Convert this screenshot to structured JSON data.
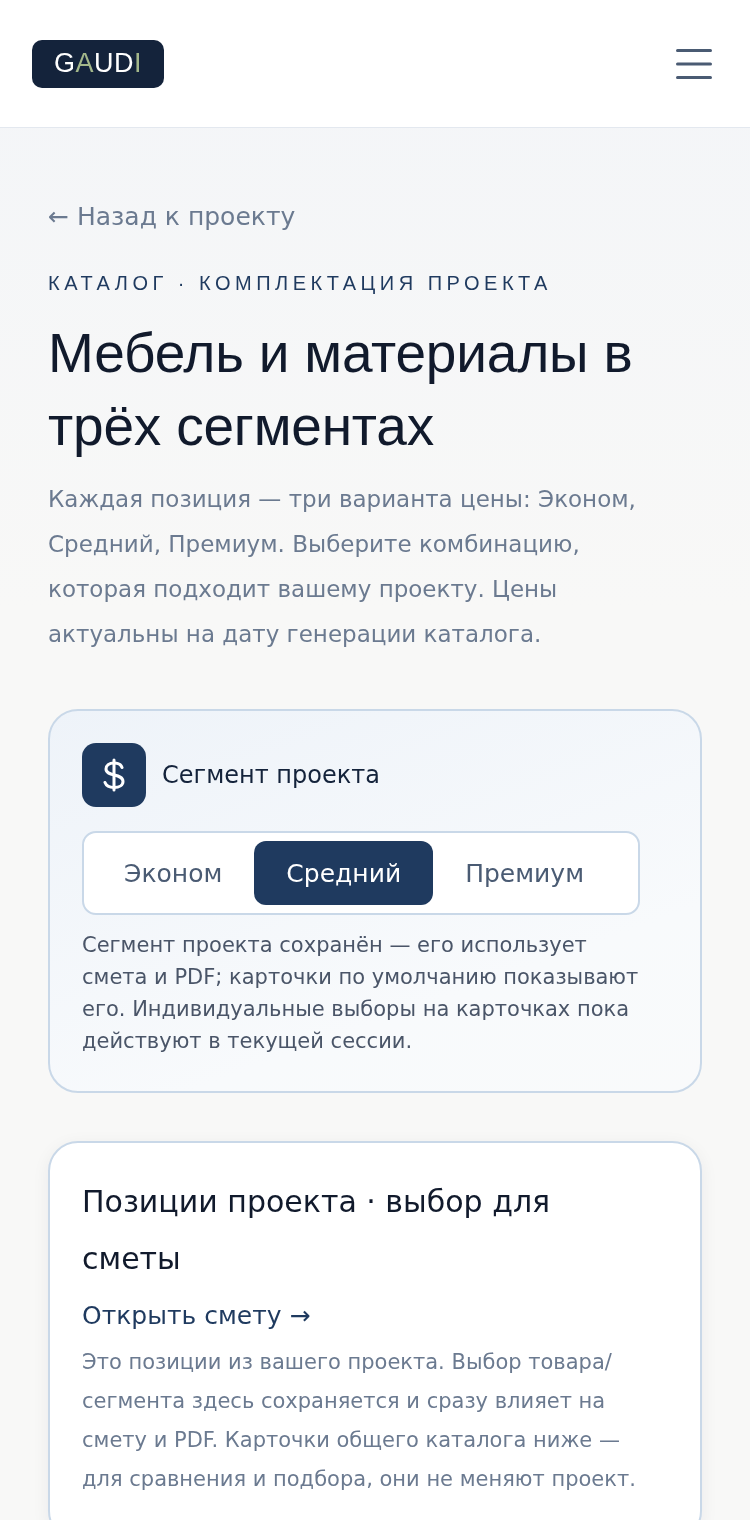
{
  "header": {
    "logo": [
      {
        "text": "G",
        "accent": false
      },
      {
        "text": "A",
        "accent": true
      },
      {
        "text": "UD",
        "accent": false
      },
      {
        "text": "I",
        "accent": true
      }
    ]
  },
  "back_link": "← Назад к проекту",
  "eyebrow": "КАТАЛОГ · КОМПЛЕКТАЦИЯ ПРОЕКТА",
  "title": "Мебель и материалы в трёх сегментах",
  "intro": "Каждая позиция — три варианта цены: Эконом, Средний, Премиум. Выберите комбинацию, которая подходит вашему проекту. Цены актуальны на дату генерации каталога.",
  "segment_card": {
    "title": "Сегмент проекта",
    "options": [
      {
        "label": "Эконом",
        "selected": false
      },
      {
        "label": "Средний",
        "selected": true
      },
      {
        "label": "Премиум",
        "selected": false
      }
    ],
    "note": "Сегмент проекта сохранён — его использует смета и PDF; карточки по умолчанию показывают его. Индивидуальные выборы на карточках пока действуют в текущей сессии."
  },
  "positions_card": {
    "title": "Позиции проекта · выбор для сметы",
    "link": "Открыть смету →",
    "description": "Это позиции из вашего проекта. Выбор товара/ сегмента здесь сохраняется и сразу влияет на смету и PDF. Карточки общего каталога ниже — для сравнения и подбора, они не меняют проект."
  }
}
